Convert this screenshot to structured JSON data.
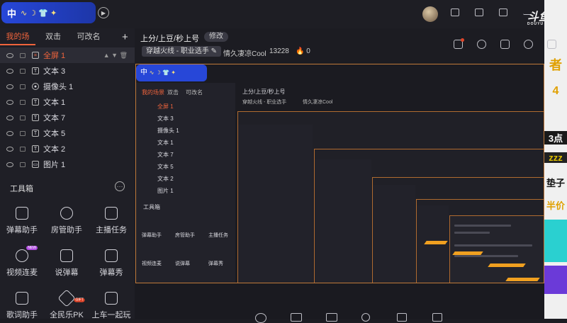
{
  "ime": {
    "label": "中",
    "glyphs": "∿ ☽ 👕 ✦"
  },
  "tabs": [
    {
      "label": "我的场景",
      "active": true
    },
    {
      "label": "双击",
      "active": false
    },
    {
      "label": "可改名",
      "active": false
    }
  ],
  "add_label": "+",
  "layers": [
    {
      "name": "全屏 1",
      "type": "crop-icon",
      "selected": true
    },
    {
      "name": "文本 3",
      "type": "text-icon"
    },
    {
      "name": "摄像头 1",
      "type": "camera-icon"
    },
    {
      "name": "文本 1",
      "type": "text-icon"
    },
    {
      "name": "文本 7",
      "type": "text-icon"
    },
    {
      "name": "文本 5",
      "type": "text-icon"
    },
    {
      "name": "文本 2",
      "type": "text-icon"
    },
    {
      "name": "图片 1",
      "type": "image-icon"
    }
  ],
  "toolbox": {
    "title": "工具箱",
    "more": "···",
    "tools": [
      {
        "label": "弹幕助手"
      },
      {
        "label": "房管助手"
      },
      {
        "label": "主播任务"
      },
      {
        "label": "视频连麦",
        "badge": "NEW"
      },
      {
        "label": "说弹幕"
      },
      {
        "label": "弹幕秀"
      },
      {
        "label": "歌词助手"
      },
      {
        "label": "全民乐PK",
        "badge": "GIFT"
      },
      {
        "label": "上车一起玩"
      }
    ]
  },
  "header": {
    "title": "上分/上豆/秒上号",
    "edit_label": "修改",
    "category": "穿越火线 - 职业选手",
    "streamer": "情久凄凉Cool",
    "room_id": "13228",
    "hot_count": "0"
  },
  "logo": {
    "text": "斗鱼",
    "sub": "DOUYU"
  },
  "right_strip": {
    "texts": [
      "者",
      "4",
      "3点",
      "zzz",
      "垫子",
      "半价"
    ]
  },
  "colors": {
    "accent": "#f0643c",
    "ime": "#2747d8",
    "border": "#c07a3a"
  }
}
